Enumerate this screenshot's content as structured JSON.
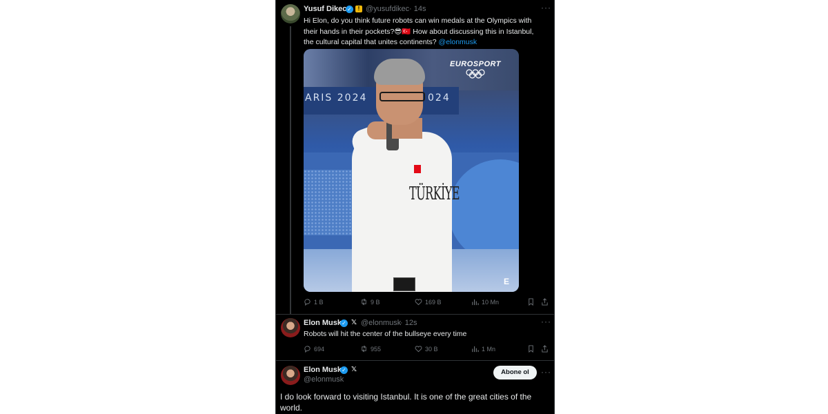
{
  "tweets": [
    {
      "name": "Yusuf Dikec",
      "handle": "@yusufdikec",
      "time": "· 14s",
      "text_part1": "Hi Elon, do you think future robots can win medals at the Olympics with their hands in their pockets?",
      "emojis": "😎🇹🇷",
      "text_part2": " How about discussing this in Istanbul, the cultural capital that unites continents? ",
      "mention": "@elonmusk",
      "media": {
        "watermark": "EUROSPORT",
        "banner_left": "ARIS 2024",
        "banner_right": "024",
        "jersey_text": "TÜRKİYE",
        "corner_logo": "E"
      },
      "stats": {
        "replies": "1 B",
        "retweets": "9 B",
        "likes": "169 B",
        "views": "10 Mn"
      }
    },
    {
      "name": "Elon Musk",
      "handle": "@elonmusk",
      "time": "· 12s",
      "text": "Robots will hit the center of the bullseye every time",
      "stats": {
        "replies": "694",
        "retweets": "955",
        "likes": "30 B",
        "views": "1 Mn"
      }
    },
    {
      "name": "Elon Musk",
      "handle": "@elonmusk",
      "follow_label": "Abone ol",
      "text": "I do look forward to visiting Istanbul. It is one of the great cities of the world."
    }
  ],
  "icons": {
    "verified": "✓",
    "x_logo": "𝕏",
    "more": "···",
    "gold_badge": "!"
  },
  "colors": {
    "accent": "#1d9bf0",
    "background": "#000000",
    "muted": "#71767b"
  }
}
